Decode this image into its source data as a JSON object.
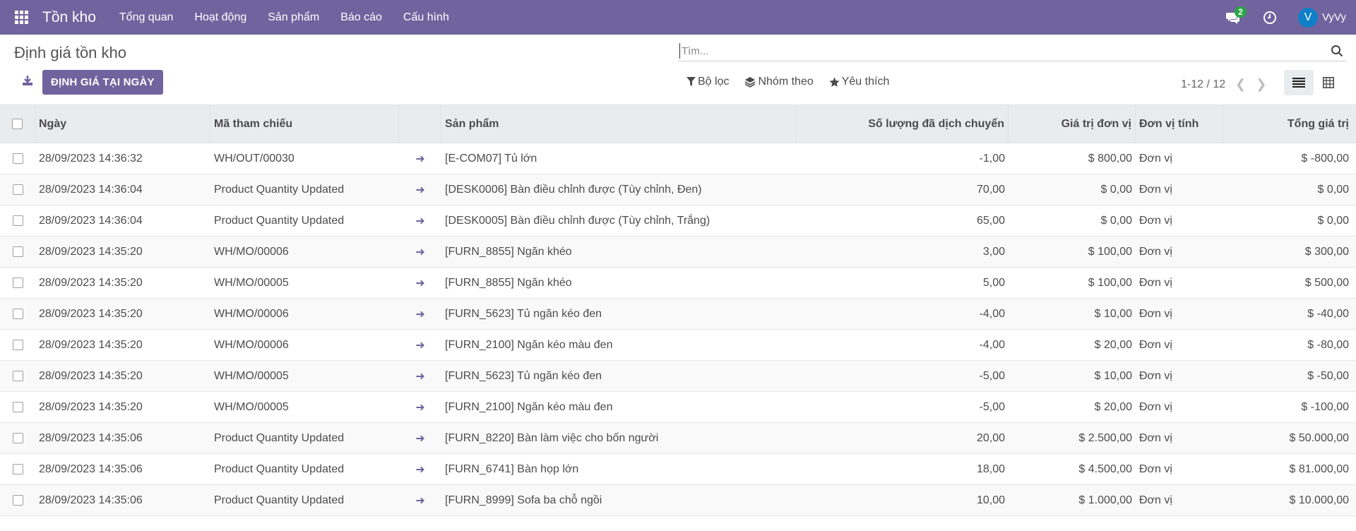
{
  "navbar": {
    "brand": "Tồn kho",
    "menu": [
      "Tổng quan",
      "Hoạt động",
      "Sản phẩm",
      "Báo cáo",
      "Cấu hình"
    ],
    "chat_count": "2",
    "user_initial": "V",
    "user_name": "VyVy"
  },
  "control": {
    "title": "Định giá tồn kho",
    "valuation_button": "ĐỊNH GIÁ TẠI NGÀY",
    "search_placeholder": "Tìm...",
    "filter_label": "Bộ lọc",
    "group_label": "Nhóm theo",
    "favorite_label": "Yêu thích",
    "pager": "1-12 / 12"
  },
  "table": {
    "headers": {
      "date": "Ngày",
      "ref": "Mã tham chiếu",
      "product": "Sản phẩm",
      "qty": "Số lượng đã dịch chuyển",
      "unit_value": "Giá trị đơn vị",
      "uom": "Đơn vị tính",
      "total": "Tổng giá trị"
    },
    "rows": [
      {
        "date": "28/09/2023 14:36:32",
        "ref": "WH/OUT/00030",
        "product": "[E-COM07] Tủ lớn",
        "qty": "-1,00",
        "unit_value": "$ 800,00",
        "uom": "Đơn vị",
        "total": "$ -800,00"
      },
      {
        "date": "28/09/2023 14:36:04",
        "ref": "Product Quantity Updated",
        "product": "[DESK0006] Bàn điều chỉnh được (Tùy chỉnh, Đen)",
        "qty": "70,00",
        "unit_value": "$ 0,00",
        "uom": "Đơn vị",
        "total": "$ 0,00"
      },
      {
        "date": "28/09/2023 14:36:04",
        "ref": "Product Quantity Updated",
        "product": "[DESK0005] Bàn điều chỉnh được (Tùy chỉnh, Trắng)",
        "qty": "65,00",
        "unit_value": "$ 0,00",
        "uom": "Đơn vị",
        "total": "$ 0,00"
      },
      {
        "date": "28/09/2023 14:35:20",
        "ref": "WH/MO/00006",
        "product": "[FURN_8855] Ngăn khéo",
        "qty": "3,00",
        "unit_value": "$ 100,00",
        "uom": "Đơn vị",
        "total": "$ 300,00"
      },
      {
        "date": "28/09/2023 14:35:20",
        "ref": "WH/MO/00005",
        "product": "[FURN_8855] Ngăn khéo",
        "qty": "5,00",
        "unit_value": "$ 100,00",
        "uom": "Đơn vị",
        "total": "$ 500,00"
      },
      {
        "date": "28/09/2023 14:35:20",
        "ref": "WH/MO/00006",
        "product": "[FURN_5623] Tủ ngăn kéo đen",
        "qty": "-4,00",
        "unit_value": "$ 10,00",
        "uom": "Đơn vị",
        "total": "$ -40,00"
      },
      {
        "date": "28/09/2023 14:35:20",
        "ref": "WH/MO/00006",
        "product": "[FURN_2100] Ngăn kéo màu đen",
        "qty": "-4,00",
        "unit_value": "$ 20,00",
        "uom": "Đơn vị",
        "total": "$ -80,00"
      },
      {
        "date": "28/09/2023 14:35:20",
        "ref": "WH/MO/00005",
        "product": "[FURN_5623] Tủ ngăn kéo đen",
        "qty": "-5,00",
        "unit_value": "$ 10,00",
        "uom": "Đơn vị",
        "total": "$ -50,00"
      },
      {
        "date": "28/09/2023 14:35:20",
        "ref": "WH/MO/00005",
        "product": "[FURN_2100] Ngăn kéo màu đen",
        "qty": "-5,00",
        "unit_value": "$ 20,00",
        "uom": "Đơn vị",
        "total": "$ -100,00"
      },
      {
        "date": "28/09/2023 14:35:06",
        "ref": "Product Quantity Updated",
        "product": "[FURN_8220] Bàn làm việc cho bốn người",
        "qty": "20,00",
        "unit_value": "$ 2.500,00",
        "uom": "Đơn vị",
        "total": "$ 50.000,00"
      },
      {
        "date": "28/09/2023 14:35:06",
        "ref": "Product Quantity Updated",
        "product": "[FURN_6741] Bàn họp lớn",
        "qty": "18,00",
        "unit_value": "$ 4.500,00",
        "uom": "Đơn vị",
        "total": "$ 81.000,00"
      },
      {
        "date": "28/09/2023 14:35:06",
        "ref": "Product Quantity Updated",
        "product": "[FURN_8999] Sofa ba chỗ ngồi",
        "qty": "10,00",
        "unit_value": "$ 1.000,00",
        "uom": "Đơn vị",
        "total": "$ 10.000,00"
      }
    ]
  },
  "colors": {
    "brand": "#71639e",
    "badge": "#28a745",
    "avatar": "#0f7fc9"
  }
}
